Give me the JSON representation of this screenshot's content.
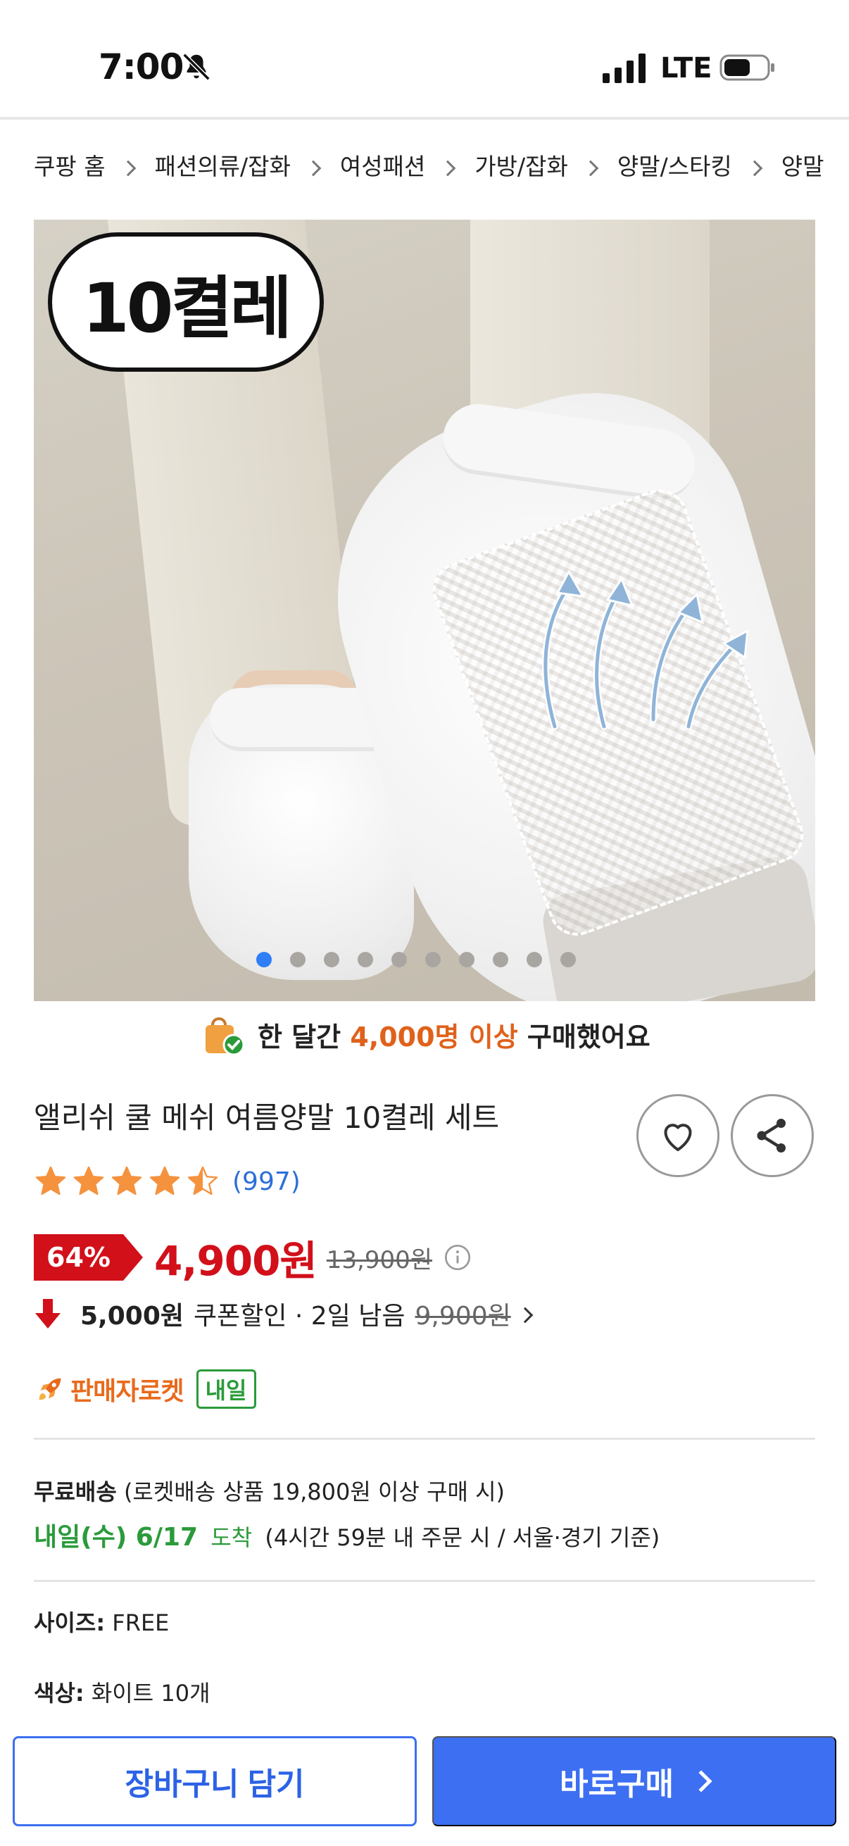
{
  "status_bar": {
    "time": "7:00",
    "network": "LTE"
  },
  "breadcrumb": [
    "쿠팡 홈",
    "패션의류/잡화",
    "여성패션",
    "가방/잡화",
    "양말/스타킹",
    "양말"
  ],
  "gallery": {
    "badge": "10켤레",
    "total_images": 10,
    "active_index": 1
  },
  "social_proof": {
    "prefix": "한 달간",
    "highlight": "4,000명 이상",
    "suffix": "구매했어요"
  },
  "product": {
    "title": "앨리쉬 쿨 메쉬 여름양말 10켤레 세트",
    "rating": 4.5,
    "review_count": "(997)"
  },
  "price": {
    "discount": "64%",
    "sale": "4,900원",
    "original": "13,900원"
  },
  "coupon": {
    "amount": "5,000원",
    "label": "쿠폰할인 · 2일 남음",
    "price": "9,900원"
  },
  "seller": {
    "label": "판매자로켓",
    "badge": "내일"
  },
  "shipping": {
    "free_label": "무료배송",
    "free_condition": "(로켓배송 상품 19,800원 이상 구매 시)",
    "date": "내일(수) 6/17",
    "arrive": "도착",
    "condition": "(4시간 59분 내 주문 시 / 서울·경기 기준)"
  },
  "options": {
    "size_label": "사이즈:",
    "size_value": "FREE",
    "color_label": "색상:",
    "color_value": "화이트 10개"
  },
  "actions": {
    "cart": "장바구니 담기",
    "buy": "바로구매"
  },
  "colors": {
    "accent_blue": "#3d6ff2",
    "price_red": "#d1101a",
    "highlight_orange": "#e0611b",
    "rocket_green": "#2a9b3a"
  }
}
